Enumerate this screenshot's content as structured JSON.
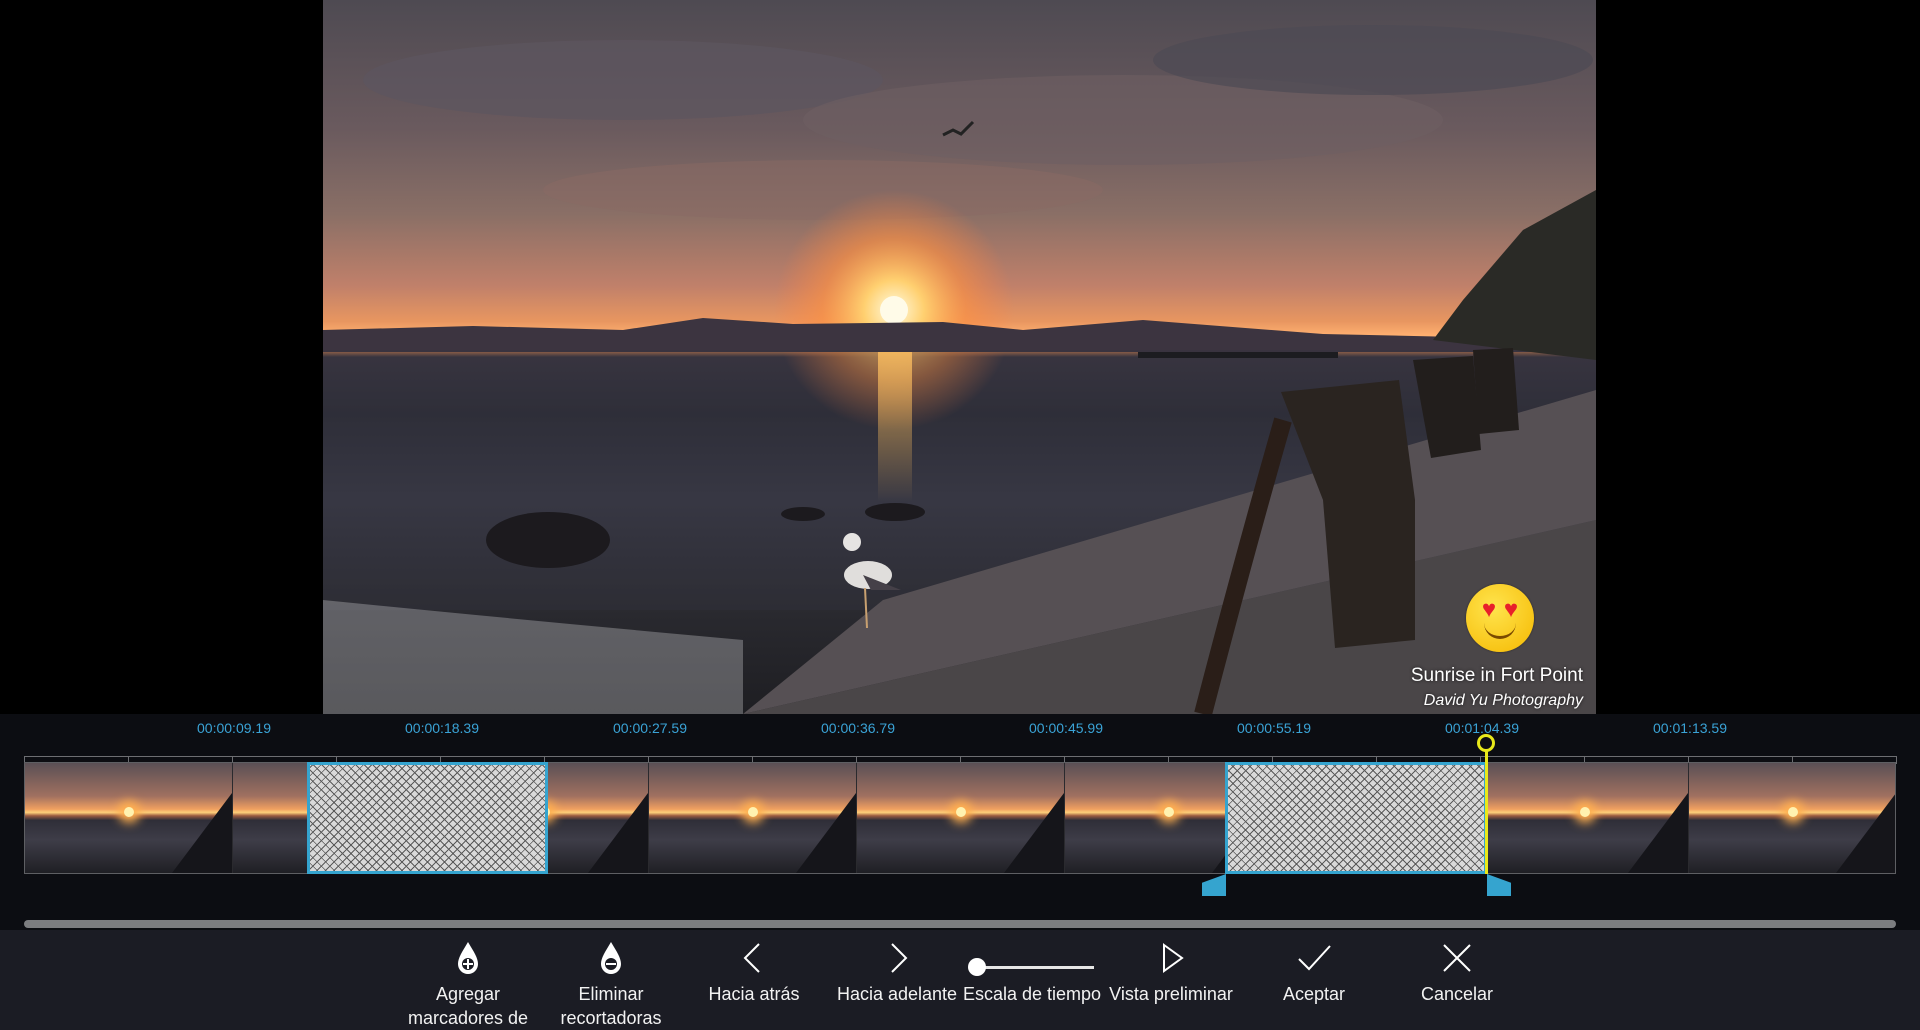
{
  "preview": {
    "title": "Sunrise in Fort Point",
    "credit": "David Yu Photography",
    "emoji": "heart-eyes-emoji"
  },
  "timeline": {
    "time_labels": [
      "00:00:09.19",
      "00:00:18.39",
      "00:00:27.59",
      "00:00:36.79",
      "00:00:45.99",
      "00:00:55.19",
      "00:01:04.39",
      "00:01:13.59"
    ],
    "thumbnail_count": 9,
    "accent_color": "#35a4cf",
    "playhead_color": "#e8e81a",
    "playhead_time": "00:01:04.39"
  },
  "toolbar": {
    "add_markers": "Agregar marcadores de",
    "remove_markers": "Eliminar recortadoras",
    "back": "Hacia atrás",
    "forward": "Hacia adelante",
    "time_scale": "Escala de tiempo",
    "preview": "Vista preliminar",
    "accept": "Aceptar",
    "cancel": "Cancelar"
  }
}
